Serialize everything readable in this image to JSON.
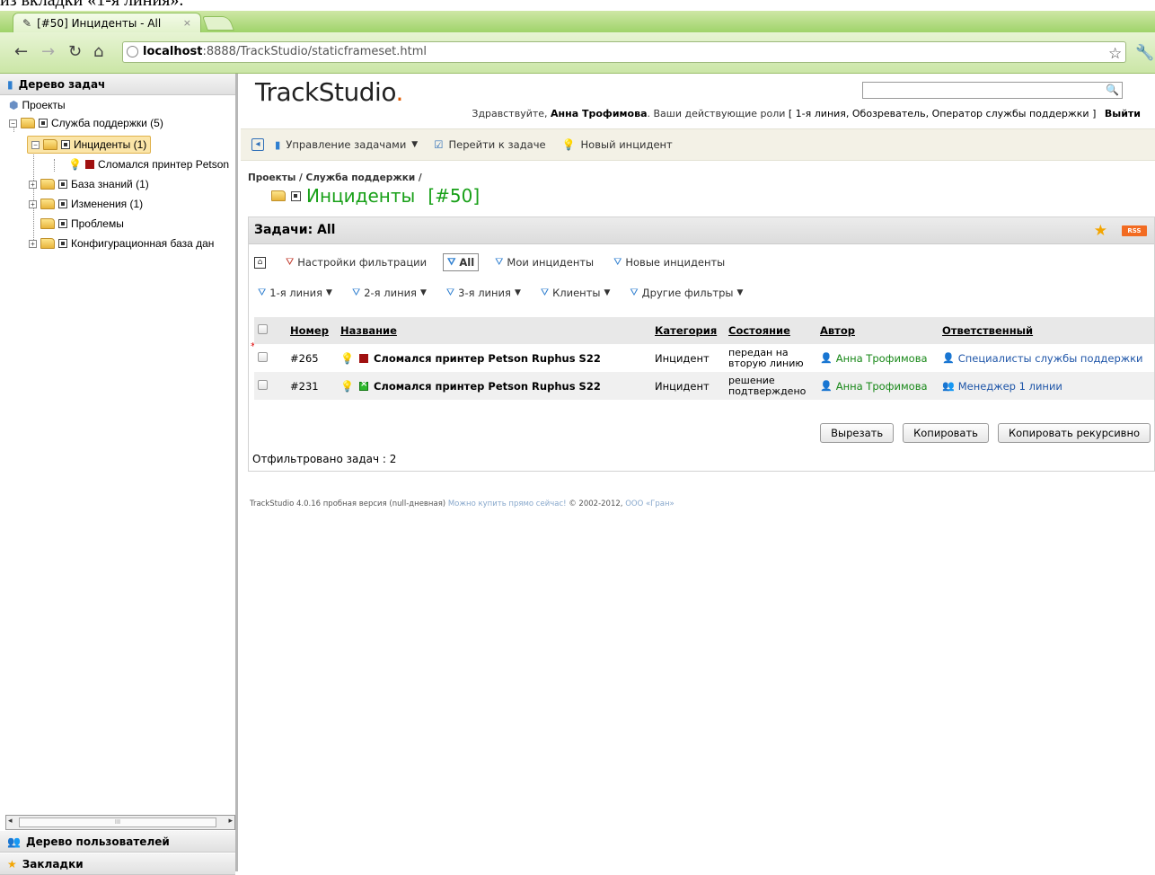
{
  "doc_fragment": "из вкладки «1-я линия».",
  "browser": {
    "tab_title": "[#50] Инциденты - All",
    "tab_close": "×",
    "url_host": "localhost",
    "url_rest": ":8888/TrackStudio/staticframeset.html"
  },
  "left_panel": {
    "title": "Дерево задач",
    "tree": {
      "projects": "Проекты",
      "support": "Служба поддержки (5)",
      "incidents": "Инциденты (1)",
      "printer": "Сломался принтер Petson",
      "kb": "База знаний (1)",
      "changes": "Изменения (1)",
      "problems": "Проблемы",
      "cmdb": "Конфигурационная база дан"
    },
    "users_title": "Дерево пользователей",
    "bookmarks_title": "Закладки"
  },
  "header": {
    "logo": "TrackStudio",
    "logo_dot": ".",
    "welcome_prefix": "Здравствуйте,",
    "user_name": "Анна Трофимова",
    "roles_prefix": ". Ваши действующие роли",
    "roles": "[ 1-я линия, Обозреватель, Оператор службы поддержки ]",
    "logout": "Выйти"
  },
  "actions": {
    "manage": "Управление задачами",
    "goto": "Перейти к задаче",
    "new_incident": "Новый инцидент"
  },
  "breadcrumb": "Проекты / Служба поддержки /",
  "page_title": "Инциденты",
  "page_id": "[#50]",
  "tasks": {
    "title": "Задачи: All",
    "rss": "RSS",
    "filters_row1": {
      "settings": "Настройки фильтрации",
      "all": "All",
      "my": "Мои инциденты",
      "new": "Новые инциденты"
    },
    "filters_row2": {
      "line1": "1-я линия",
      "line2": "2-я линия",
      "line3": "3-я линия",
      "clients": "Клиенты",
      "other": "Другие фильтры"
    },
    "columns": {
      "number": "Номер",
      "name": "Название",
      "category": "Категория",
      "state": "Состояние",
      "author": "Автор",
      "responsible": "Ответственный"
    },
    "required_mark": "*",
    "rows": [
      {
        "number": "#265",
        "name": "Сломался принтер Petson Ruphus S22",
        "category": "Инцидент",
        "state_l1": "передан на",
        "state_l2": "вторую линию",
        "author": "Анна Трофимова",
        "responsible": "Специалисты службы поддержки"
      },
      {
        "number": "#231",
        "name": "Сломался принтер Petson Ruphus S22",
        "category": "Инцидент",
        "state_l1": "решение",
        "state_l2": "подтверждено",
        "author": "Анна Трофимова",
        "responsible": "Менеджер 1 линии"
      }
    ],
    "buttons": {
      "cut": "Вырезать",
      "copy": "Копировать",
      "copy_recursive": "Копировать рекурсивно"
    },
    "filtered": "Отфильтровано задач : 2"
  },
  "footer": {
    "text1": "TrackStudio 4.0.16 пробная версия (null-дневная)",
    "buy_link": "Можно купить прямо сейчас!",
    "text2": "© 2002-2012,",
    "company_link": "ООО «Гран»"
  },
  "colors": {
    "title_green": "#18a018",
    "link_green": "#188818",
    "link_blue": "#1e55a8",
    "chrome_green": "#9fd36a"
  }
}
